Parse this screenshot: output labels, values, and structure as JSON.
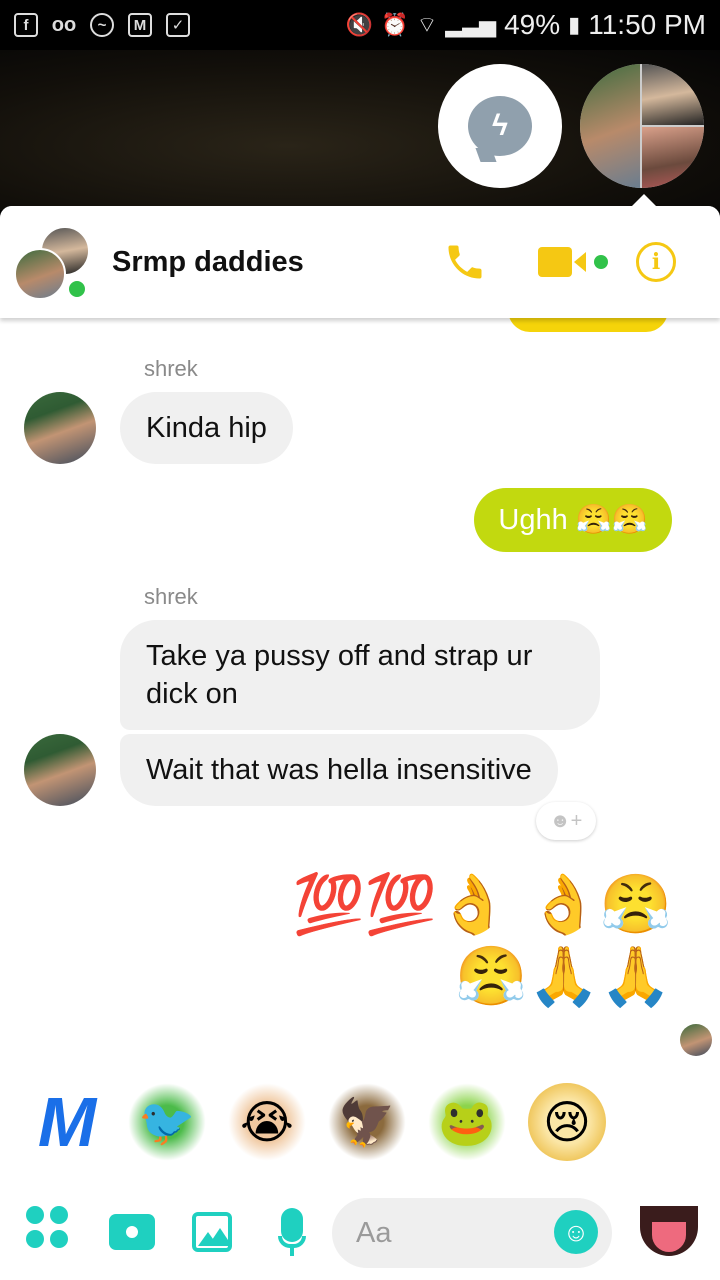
{
  "status_bar": {
    "left_icons": [
      "facebook-icon",
      "voicemail-icon",
      "messenger-icon",
      "gmail-icon",
      "checklist-icon"
    ],
    "battery": "49%",
    "time": "11:50 PM"
  },
  "header": {
    "title": "Srmp daddies",
    "accent_color": "#f5c813",
    "online_color": "#31c24a"
  },
  "messages": [
    {
      "sender": "shrek",
      "text": "Kinda hip"
    },
    {
      "outgoing_text": "Ughh 😤😤"
    },
    {
      "sender": "shrek",
      "texts": [
        "Take ya pussy off and strap ur dick on",
        "Wait that was hella insensitive"
      ]
    },
    {
      "outgoing_emoji": "💯💯👌 👌😤 😤🙏🙏"
    }
  ],
  "sticker_tray": [
    "m-assistant-icon",
    "green-bird-sticker",
    "crying-man-sticker",
    "eagle-sticker",
    "om-nom-sticker",
    "crying-face-sticker"
  ],
  "composer": {
    "placeholder": "Aa",
    "teal_color": "#1fd0c0"
  },
  "reaction": "☻+"
}
